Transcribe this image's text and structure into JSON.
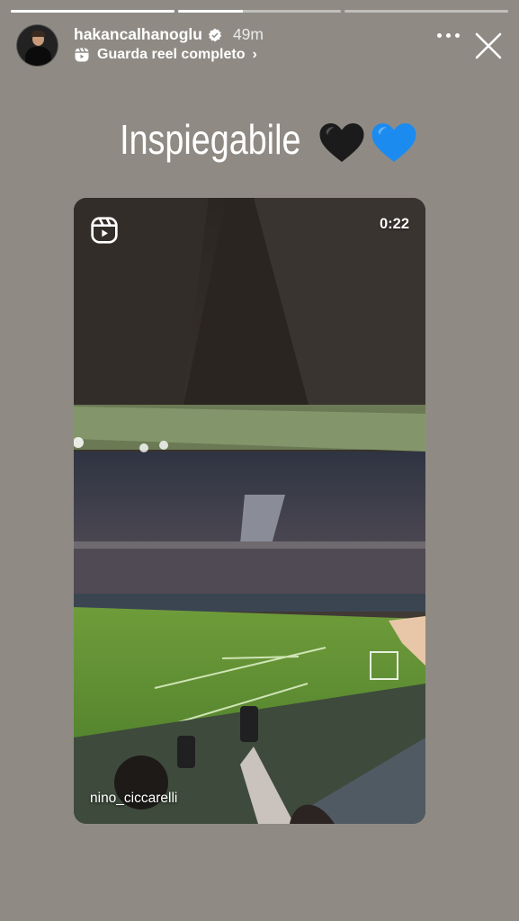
{
  "story": {
    "segments": [
      {
        "state": "viewed",
        "progress": 1.0
      },
      {
        "state": "current",
        "progress": 0.4
      },
      {
        "state": "upcoming",
        "progress": 0.0
      }
    ]
  },
  "header": {
    "username": "hakancalhanoglu",
    "verified": true,
    "time_ago": "49m",
    "reel_link_label": "Guarda reel completo",
    "chevron": "›",
    "icons": {
      "avatar": "profile-photo",
      "more": "more-dots-icon",
      "close": "close-icon",
      "reel": "reels-icon"
    }
  },
  "caption": {
    "text": "Inspiegabile",
    "emojis": [
      "black-heart",
      "blue-heart"
    ]
  },
  "video": {
    "duration": "0:22",
    "credit": "nino_ciccarelli",
    "icon": "reels-icon"
  },
  "colors": {
    "background": "#8f8b84",
    "black_heart": "#1b1b1b",
    "blue_heart": "#1c8bf0",
    "verified": "#ffffff"
  }
}
